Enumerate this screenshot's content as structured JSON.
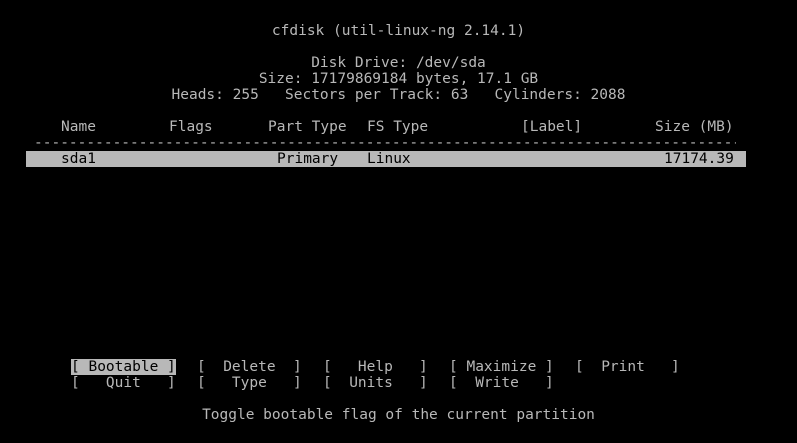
{
  "header": {
    "title": "cfdisk (util-linux-ng 2.14.1)",
    "disk_drive": "Disk Drive: /dev/sda",
    "size": "Size: 17179869184 bytes, 17.1 GB",
    "geometry": "Heads: 255   Sectors per Track: 63   Cylinders: 2088"
  },
  "table": {
    "columns": {
      "name": "Name",
      "flags": "Flags",
      "part_type": "Part Type",
      "fs_type": "FS Type",
      "label": "[Label]",
      "size": "Size (MB)"
    },
    "separator": "------------------------------------------------------------------------------------------------------------",
    "rows": [
      {
        "name": "sda1",
        "flags": "",
        "part_type": "Primary",
        "fs_type": "Linux",
        "label": "",
        "size": "17174.39"
      }
    ]
  },
  "menu": {
    "bootable": "[ Bootable ]",
    "delete": "[  Delete  ]",
    "help": "[   Help   ]",
    "maximize": "[ Maximize ]",
    "print": "[  Print   ]",
    "quit": "[   Quit   ]",
    "type": "[   Type   ]",
    "units": "[  Units   ]",
    "write": "[  Write   ]"
  },
  "status": {
    "help_text": "Toggle bootable flag of the current partition"
  },
  "colors": {
    "background": "#000000",
    "foreground": "#b8b8b8",
    "highlight": "#b8b8b8"
  }
}
